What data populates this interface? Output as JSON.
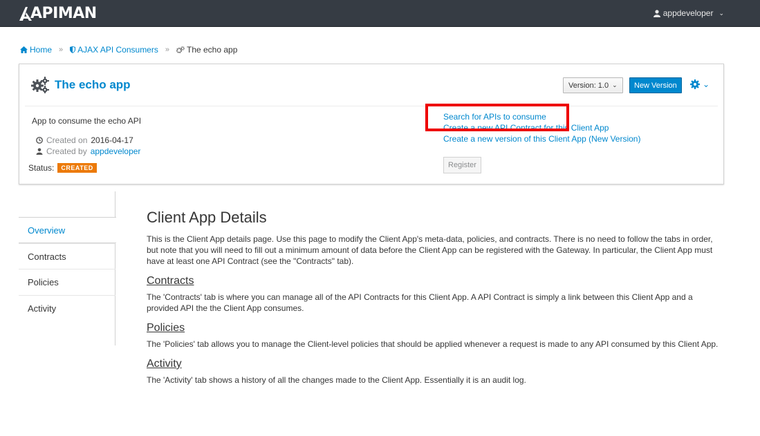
{
  "navbar": {
    "logo_text": "APIMAN",
    "user": "appdeveloper"
  },
  "breadcrumb": [
    {
      "label": "Home",
      "icon": "home-icon"
    },
    {
      "label": "AJAX API Consumers",
      "icon": "shield-icon"
    },
    {
      "label": "The echo app",
      "icon": "gears-icon"
    }
  ],
  "app": {
    "title": "The echo app",
    "description": "App to consume the echo API",
    "created_on_label": "Created on",
    "created_on": "2016-04-17",
    "created_by_label": "Created by",
    "created_by": "appdeveloper",
    "status_label": "Status:",
    "status": "CREATED",
    "status_color": "#ec7a08",
    "version_label": "Version: 1.0",
    "new_version_label": "New Version",
    "actions": [
      "Search for APIs to consume",
      "Create a new API Contract for this Client App",
      "Create a new version of this Client App (New Version)"
    ],
    "register_label": "Register"
  },
  "tabs": [
    {
      "label": "Overview",
      "active": true
    },
    {
      "label": "Contracts",
      "active": false
    },
    {
      "label": "Policies",
      "active": false
    },
    {
      "label": "Activity",
      "active": false
    }
  ],
  "content": {
    "title": "Client App Details",
    "intro": "This is the Client App details page. Use this page to modify the Client App's meta-data, policies, and contracts. There is no need to follow the tabs in order, but note that you will need to fill out a minimum amount of data before the Client App can be registered with the Gateway. In particular, the Client App must have at least one API Contract (see the \"Contracts\" tab).",
    "sections": [
      {
        "heading": "Contracts",
        "text": "The 'Contracts' tab is where you can manage all of the API Contracts for this Client App. A API Contract is simply a link between this Client App and a provided API the the Client App consumes."
      },
      {
        "heading": "Policies",
        "text": "The 'Policies' tab allows you to manage the Client-level policies that should be applied whenever a request is made to any API consumed by this Client App."
      },
      {
        "heading": "Activity",
        "text": "The 'Activity' tab shows a history of all the changes made to the Client App. Essentially it is an audit log."
      }
    ]
  },
  "colors": {
    "accent": "#0088ce",
    "navbar": "#363c44",
    "highlight": "#ee0000"
  }
}
